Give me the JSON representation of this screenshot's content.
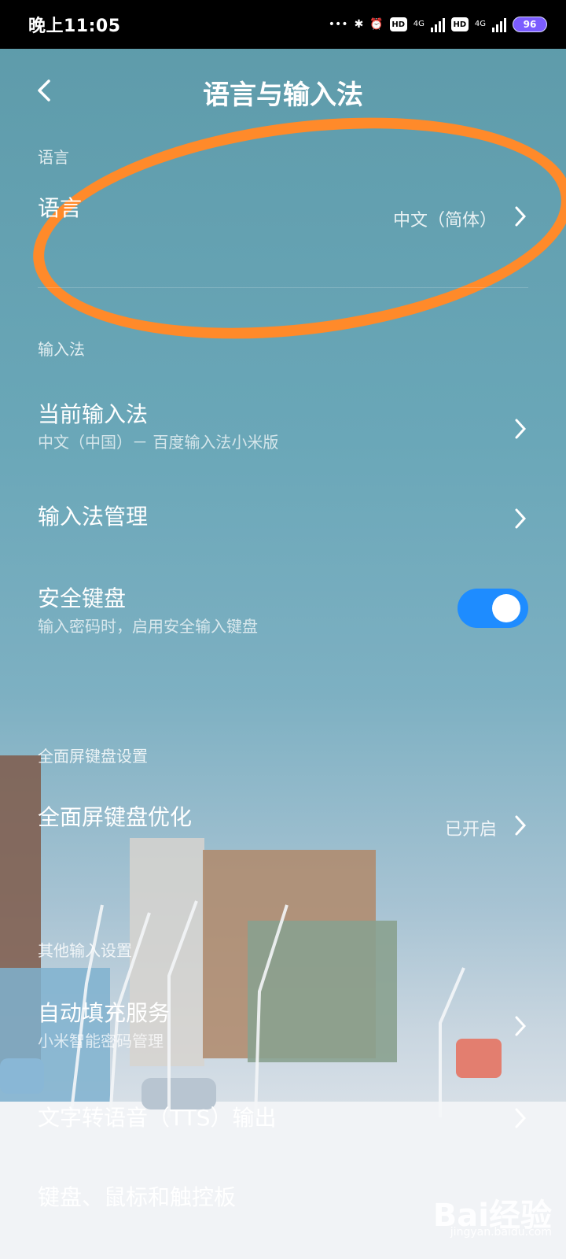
{
  "status": {
    "time": "晚上11:05",
    "battery": "96",
    "network": [
      "4G",
      "4G"
    ],
    "icons": [
      "bluetooth-icon",
      "alarm-icon",
      "hd-icon",
      "signal-icon",
      "hd-icon",
      "signal-icon",
      "battery-icon"
    ]
  },
  "header": {
    "title": "语言与输入法",
    "back_icon": "back-chevron-icon"
  },
  "sections": {
    "language": "语言",
    "input_method": "输入法",
    "fullscreen_keyboard": "全面屏键盘设置",
    "other_input": "其他输入设置"
  },
  "rows": {
    "language": {
      "label": "语言",
      "value": "中文（简体）"
    },
    "current_ime": {
      "label": "当前输入法",
      "sub": "中文（中国）－ 百度输入法小米版"
    },
    "ime_manage": {
      "label": "输入法管理"
    },
    "secure_keyboard": {
      "label": "安全键盘",
      "sub": "输入密码时，启用安全输入键盘",
      "enabled": true
    },
    "fullscreen_opt": {
      "label": "全面屏键盘优化",
      "value": "已开启"
    },
    "autofill": {
      "label": "自动填充服务",
      "sub": "小米智能密码管理"
    },
    "tts": {
      "label": "文字转语音（TTS）输出"
    },
    "keyboard_mouse": {
      "label": "键盘、鼠标和触控板"
    }
  },
  "watermark": {
    "brand": "Bai经验",
    "url": "jingyan.baidu.com"
  },
  "colors": {
    "toggle_on": "#1e8cff",
    "annotation_orange": "#ff8a2a"
  }
}
